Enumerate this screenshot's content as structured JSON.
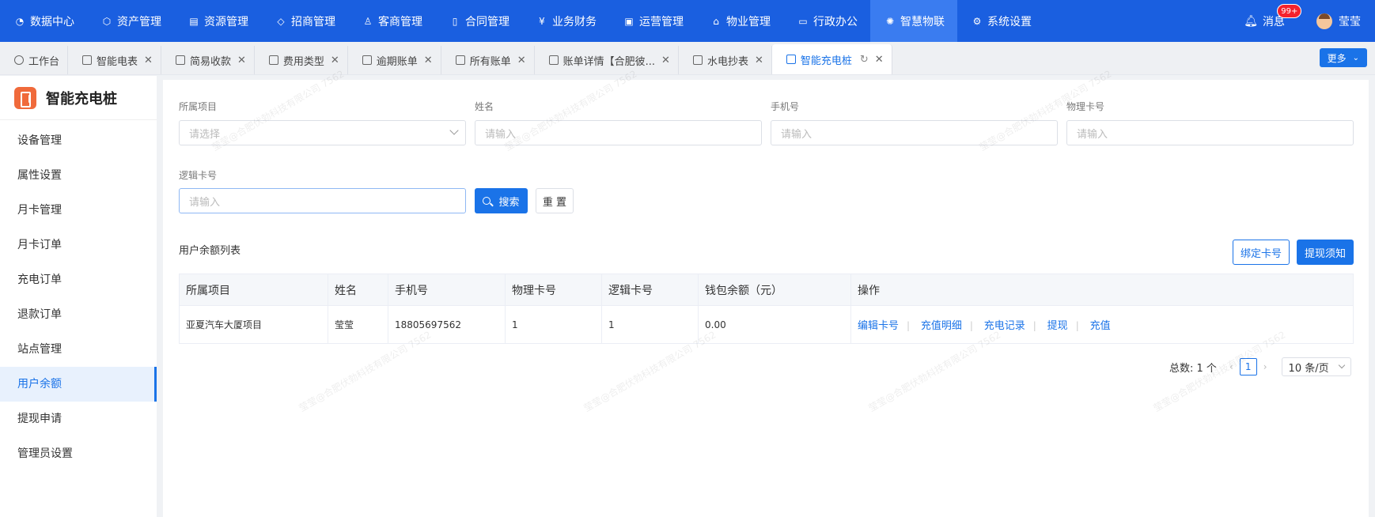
{
  "topnav": {
    "items": [
      {
        "label": "数据中心",
        "icon": "pie-chart-icon"
      },
      {
        "label": "资产管理",
        "icon": "cube-icon"
      },
      {
        "label": "资源管理",
        "icon": "building-icon"
      },
      {
        "label": "招商管理",
        "icon": "tag-icon"
      },
      {
        "label": "客商管理",
        "icon": "users-icon"
      },
      {
        "label": "合同管理",
        "icon": "document-icon"
      },
      {
        "label": "业务财务",
        "icon": "yen-icon"
      },
      {
        "label": "运营管理",
        "icon": "chart-icon"
      },
      {
        "label": "物业管理",
        "icon": "home-icon"
      },
      {
        "label": "行政办公",
        "icon": "monitor-icon"
      },
      {
        "label": "智慧物联",
        "icon": "iot-icon",
        "active": true
      },
      {
        "label": "系统设置",
        "icon": "gear-icon"
      }
    ],
    "message_label": "消息",
    "message_badge": "99+",
    "user_name": "莹莹"
  },
  "tabs": {
    "items": [
      {
        "label": "工作台",
        "closable": false
      },
      {
        "label": "智能电表",
        "closable": true
      },
      {
        "label": "简易收款",
        "closable": true
      },
      {
        "label": "费用类型",
        "closable": true
      },
      {
        "label": "逾期账单",
        "closable": true
      },
      {
        "label": "所有账单",
        "closable": true
      },
      {
        "label": "账单详情【合肥彼...",
        "closable": true
      },
      {
        "label": "水电抄表",
        "closable": true
      },
      {
        "label": "智能充电桩",
        "closable": true,
        "active": true
      }
    ],
    "more_label": "更多"
  },
  "sidebar": {
    "title": "智能充电桩",
    "items": [
      {
        "label": "设备管理"
      },
      {
        "label": "属性设置"
      },
      {
        "label": "月卡管理"
      },
      {
        "label": "月卡订单"
      },
      {
        "label": "充电订单"
      },
      {
        "label": "退款订单"
      },
      {
        "label": "站点管理"
      },
      {
        "label": "用户余额",
        "active": true
      },
      {
        "label": "提现申请"
      },
      {
        "label": "管理员设置"
      }
    ]
  },
  "filters": {
    "project_label": "所属项目",
    "project_placeholder": "请选择",
    "name_label": "姓名",
    "name_placeholder": "请输入",
    "phone_label": "手机号",
    "phone_placeholder": "请输入",
    "physical_card_label": "物理卡号",
    "physical_card_placeholder": "请输入",
    "logic_card_label": "逻辑卡号",
    "logic_card_placeholder": "请输入",
    "search_label": "搜索",
    "reset_label": "重 置"
  },
  "list": {
    "title": "用户余额列表",
    "bind_card_label": "绑定卡号",
    "withdraw_notice_label": "提现须知",
    "columns": [
      "所属项目",
      "姓名",
      "手机号",
      "物理卡号",
      "逻辑卡号",
      "钱包余额（元）",
      "操作"
    ],
    "rows": [
      {
        "project": "亚夏汽车大厦项目",
        "name": "莹莹",
        "phone": "18805697562",
        "physical_card": "1",
        "logic_card": "1",
        "balance": "0.00",
        "actions": [
          "编辑卡号",
          "充值明细",
          "充电记录",
          "提现",
          "充值"
        ]
      }
    ]
  },
  "pagination": {
    "total_label": "总数: 1 个",
    "current_page": "1",
    "page_size": "10 条/页"
  },
  "watermark": "莹莹@合肥伏勃科技有限公司 7562"
}
